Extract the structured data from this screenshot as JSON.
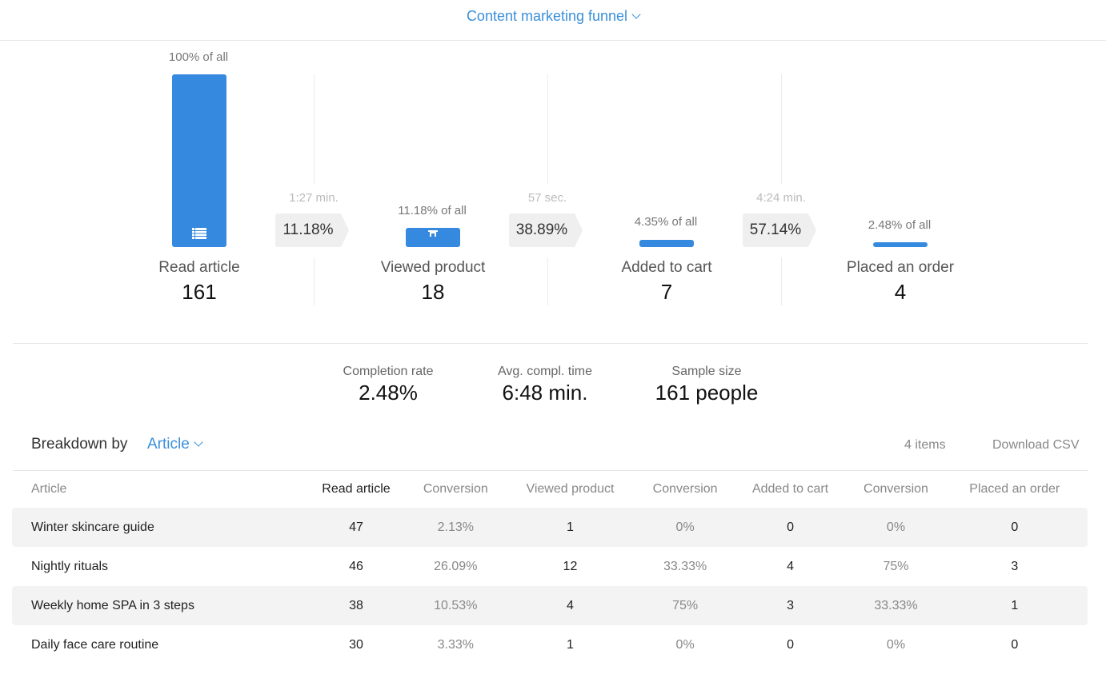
{
  "header": {
    "title": "Content marketing funnel"
  },
  "funnel": {
    "steps": [
      {
        "name": "Read article",
        "count": "161",
        "pct_of_all_label": "100% of all",
        "pct_of_all": 100,
        "icon": "list-icon"
      },
      {
        "name": "Viewed product",
        "count": "18",
        "pct_of_all_label": "11.18% of all",
        "pct_of_all": 11.18,
        "icon": "cart-icon"
      },
      {
        "name": "Added to cart",
        "count": "7",
        "pct_of_all_label": "4.35% of all",
        "pct_of_all": 4.35,
        "icon": ""
      },
      {
        "name": "Placed an order",
        "count": "4",
        "pct_of_all_label": "2.48% of all",
        "pct_of_all": 2.48,
        "icon": ""
      }
    ],
    "transitions": [
      {
        "time": "1:27 min.",
        "conversion": "11.18%"
      },
      {
        "time": "57 sec.",
        "conversion": "38.89%"
      },
      {
        "time": "4:24 min.",
        "conversion": "57.14%"
      }
    ]
  },
  "stats": {
    "completion_rate": {
      "label": "Completion rate",
      "value": "2.48%"
    },
    "avg_time": {
      "label": "Avg. compl. time",
      "value": "6:48 min."
    },
    "sample_size": {
      "label": "Sample size",
      "value": "161 people"
    }
  },
  "breakdown": {
    "label": "Breakdown by",
    "selected": "Article",
    "items_count": "4 items",
    "download_label": "Download CSV"
  },
  "table": {
    "columns": [
      "Article",
      "Read article",
      "Conversion",
      "Viewed product",
      "Conversion",
      "Added to cart",
      "Conversion",
      "Placed an order"
    ],
    "rows": [
      [
        "Winter skincare guide",
        "47",
        "2.13%",
        "1",
        "0%",
        "0",
        "0%",
        "0"
      ],
      [
        "Nightly rituals",
        "46",
        "26.09%",
        "12",
        "33.33%",
        "4",
        "75%",
        "3"
      ],
      [
        "Weekly home SPA in 3 steps",
        "38",
        "10.53%",
        "4",
        "75%",
        "3",
        "33.33%",
        "1"
      ],
      [
        "Daily face care routine",
        "30",
        "3.33%",
        "1",
        "0%",
        "0",
        "0%",
        "0"
      ]
    ]
  },
  "colors": {
    "accent": "#3a8fd9",
    "bar": "#3589de"
  }
}
